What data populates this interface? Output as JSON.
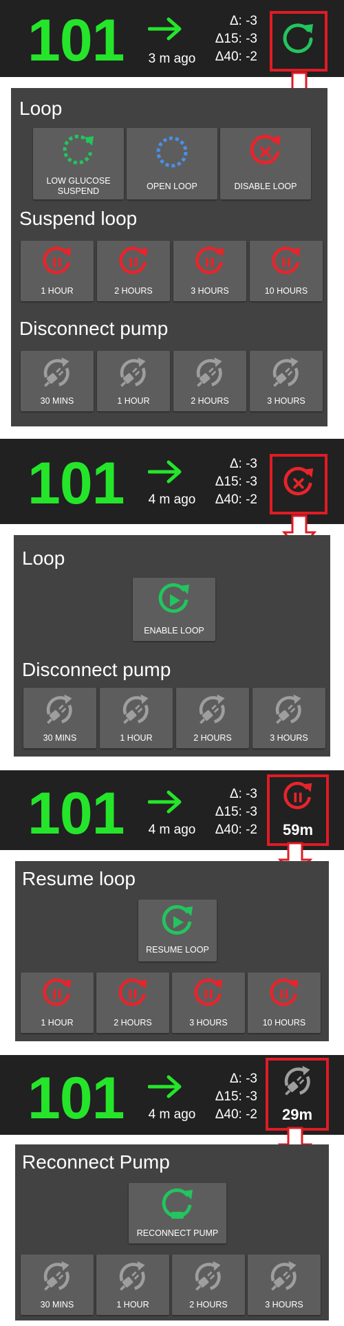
{
  "colors": {
    "header_bg": "#212121",
    "panel_bg": "#424242",
    "button_bg": "#5d5d5d",
    "glucose_green": "#25e52b",
    "loop_green": "#22c55e",
    "open_blue": "#4a90e2",
    "alert_red": "#e8242b",
    "pump_gray": "#9e9e9e",
    "highlight_red": "#e01b24"
  },
  "screens": [
    {
      "header": {
        "glucose": "101",
        "trend_icon": "arrow-right-icon",
        "ago": "3 m ago",
        "delta": "Δ: -3",
        "delta15": "Δ15: -3",
        "delta40": "Δ40: -2",
        "status_icon": "loop-closed-icon",
        "timer": ""
      },
      "sections": [
        {
          "title": "Loop",
          "buttons": [
            {
              "label": "LOW GLUCOSE SUSPEND",
              "icon": "low-glucose-suspend-icon"
            },
            {
              "label": "OPEN LOOP",
              "icon": "open-loop-icon"
            },
            {
              "label": "DISABLE LOOP",
              "icon": "disable-loop-icon"
            }
          ]
        },
        {
          "title": "Suspend loop",
          "buttons": [
            {
              "label": "1 HOUR",
              "icon": "suspend-loop-icon"
            },
            {
              "label": "2 HOURS",
              "icon": "suspend-loop-icon"
            },
            {
              "label": "3 HOURS",
              "icon": "suspend-loop-icon"
            },
            {
              "label": "10 HOURS",
              "icon": "suspend-loop-icon"
            }
          ]
        },
        {
          "title": "Disconnect pump",
          "buttons": [
            {
              "label": "30 MINS",
              "icon": "disconnect-pump-icon"
            },
            {
              "label": "1 HOUR",
              "icon": "disconnect-pump-icon"
            },
            {
              "label": "2 HOURS",
              "icon": "disconnect-pump-icon"
            },
            {
              "label": "3 HOURS",
              "icon": "disconnect-pump-icon"
            }
          ]
        }
      ]
    },
    {
      "header": {
        "glucose": "101",
        "trend_icon": "arrow-right-icon",
        "ago": "4 m ago",
        "delta": "Δ: -3",
        "delta15": "Δ15: -3",
        "delta40": "Δ40: -2",
        "status_icon": "loop-disabled-icon",
        "timer": ""
      },
      "sections": [
        {
          "title": "Loop",
          "buttons": [
            {
              "label": "ENABLE LOOP",
              "icon": "enable-loop-icon"
            }
          ]
        },
        {
          "title": "Disconnect pump",
          "buttons": [
            {
              "label": "30 MINS",
              "icon": "disconnect-pump-icon"
            },
            {
              "label": "1 HOUR",
              "icon": "disconnect-pump-icon"
            },
            {
              "label": "2 HOURS",
              "icon": "disconnect-pump-icon"
            },
            {
              "label": "3 HOURS",
              "icon": "disconnect-pump-icon"
            }
          ]
        }
      ]
    },
    {
      "header": {
        "glucose": "101",
        "trend_icon": "arrow-right-icon",
        "ago": "4 m ago",
        "delta": "Δ: -3",
        "delta15": "Δ15: -3",
        "delta40": "Δ40: -2",
        "status_icon": "loop-suspended-icon",
        "timer": "59m"
      },
      "sections": [
        {
          "title": "Resume loop",
          "buttons": [
            {
              "label": "RESUME LOOP",
              "icon": "resume-loop-icon"
            }
          ]
        },
        {
          "title": "",
          "buttons": [
            {
              "label": "1 HOUR",
              "icon": "suspend-loop-icon"
            },
            {
              "label": "2 HOURS",
              "icon": "suspend-loop-icon"
            },
            {
              "label": "3 HOURS",
              "icon": "suspend-loop-icon"
            },
            {
              "label": "10 HOURS",
              "icon": "suspend-loop-icon"
            }
          ]
        }
      ]
    },
    {
      "header": {
        "glucose": "101",
        "trend_icon": "arrow-right-icon",
        "ago": "4 m ago",
        "delta": "Δ: -3",
        "delta15": "Δ15: -3",
        "delta40": "Δ40: -2",
        "status_icon": "pump-disconnected-icon",
        "timer": "29m"
      },
      "sections": [
        {
          "title": "Reconnect Pump",
          "buttons": [
            {
              "label": "RECONNECT PUMP",
              "icon": "reconnect-pump-icon"
            }
          ]
        },
        {
          "title": "",
          "buttons": [
            {
              "label": "30 MINS",
              "icon": "disconnect-pump-icon"
            },
            {
              "label": "1 HOUR",
              "icon": "disconnect-pump-icon"
            },
            {
              "label": "2 HOURS",
              "icon": "disconnect-pump-icon"
            },
            {
              "label": "3 HOURS",
              "icon": "disconnect-pump-icon"
            }
          ]
        }
      ]
    }
  ]
}
